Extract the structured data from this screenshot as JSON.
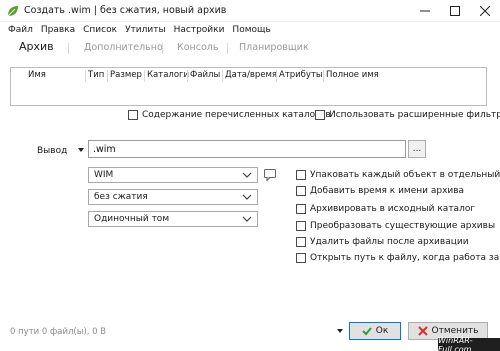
{
  "window": {
    "title": "Создать .wim | без сжатия, новый архив",
    "minimize_label": "minimize",
    "maximize_label": "maximize",
    "close_label": "close"
  },
  "menu": [
    "Файл",
    "Правка",
    "Список",
    "Утилиты",
    "Настройки",
    "Помощь"
  ],
  "tabs": {
    "archive": "Архив",
    "advanced": "Дополнительно",
    "console": "Консоль",
    "scheduler": "Планировщик"
  },
  "table": {
    "columns": [
      "Имя",
      "Тип",
      "Размер",
      "Каталоги",
      "Файлы",
      "Дата/время",
      "Атрибуты",
      "Полное имя"
    ]
  },
  "table_options": {
    "list_dir_contents": "Содержание перечисленных каталогов",
    "advanced_filters": "Использовать расширенные фильтры"
  },
  "output": {
    "label": "Вывод",
    "value": ".wim",
    "browse_label": "..."
  },
  "selects": {
    "format": "WIM",
    "compression": "без сжатия",
    "volume": "Одиночный том"
  },
  "options": [
    "Упаковать каждый объект в отдельный архи",
    "Добавить время к имени архива",
    "Архивировать в исходный каталог",
    "Преобразовать существующие архивы",
    "Удалить файлы после архивации",
    "Открыть путь к файлу, когда работа заверш"
  ],
  "status": "0 пути 0 файл(ы), 0 B",
  "buttons": {
    "ok": "Ок",
    "cancel": "Отменить"
  },
  "watermark": "WinRAR-Full.com",
  "colors": {
    "accent": "#0078d7",
    "ok_check": "#2e9e3c",
    "cancel_x": "#d9302c",
    "app_icon": "#5aa02c"
  },
  "icons": {
    "app": "leaf-icon",
    "comment": "speech-bubble-icon",
    "ok": "check-icon",
    "cancel": "x-icon"
  }
}
